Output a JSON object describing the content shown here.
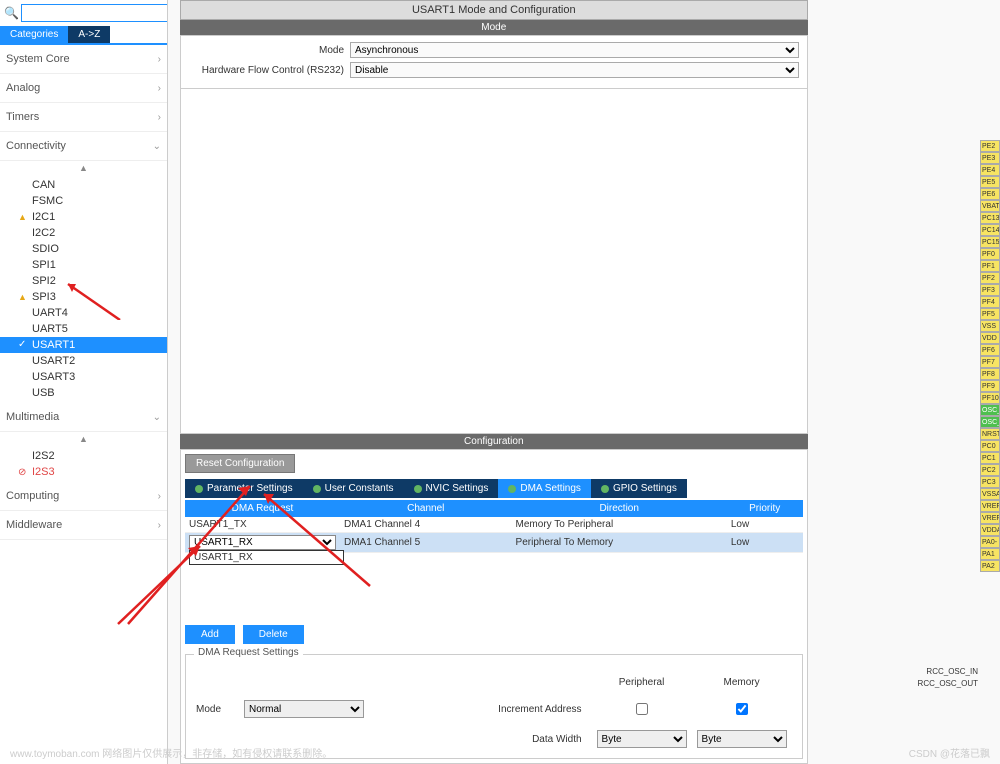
{
  "sidebar": {
    "tabs": {
      "cat": "Categories",
      "az": "A->Z"
    },
    "categories": [
      {
        "name": "System Core",
        "expanded": false
      },
      {
        "name": "Analog",
        "expanded": false
      },
      {
        "name": "Timers",
        "expanded": false
      },
      {
        "name": "Connectivity",
        "expanded": true,
        "items": [
          {
            "label": "CAN"
          },
          {
            "label": "FSMC"
          },
          {
            "label": "I2C1",
            "warn": true
          },
          {
            "label": "I2C2"
          },
          {
            "label": "SDIO"
          },
          {
            "label": "SPI1"
          },
          {
            "label": "SPI2"
          },
          {
            "label": "SPI3",
            "warn": true
          },
          {
            "label": "UART4"
          },
          {
            "label": "UART5"
          },
          {
            "label": "USART1",
            "checked": true,
            "selected": true
          },
          {
            "label": "USART2"
          },
          {
            "label": "USART3"
          },
          {
            "label": "USB"
          }
        ]
      },
      {
        "name": "Multimedia",
        "expanded": true,
        "items": [
          {
            "label": "I2S2"
          },
          {
            "label": "I2S3",
            "error": true
          }
        ]
      },
      {
        "name": "Computing",
        "expanded": false
      },
      {
        "name": "Middleware",
        "expanded": false
      }
    ]
  },
  "main": {
    "title": "USART1 Mode and Configuration",
    "mode_header": "Mode",
    "mode_label": "Mode",
    "mode_value": "Asynchronous",
    "flow_label": "Hardware Flow Control (RS232)",
    "flow_value": "Disable",
    "config_header": "Configuration",
    "reset_btn": "Reset Configuration",
    "cfg_tabs": [
      "Parameter Settings",
      "User Constants",
      "NVIC Settings",
      "DMA Settings",
      "GPIO Settings"
    ],
    "dma": {
      "headers": [
        "DMA Request",
        "Channel",
        "Direction",
        "Priority"
      ],
      "rows": [
        {
          "req": "USART1_TX",
          "ch": "DMA1 Channel 4",
          "dir": "Memory To Peripheral",
          "prio": "Low"
        },
        {
          "req": "USART1_RX",
          "ch": "DMA1 Channel 5",
          "dir": "Peripheral To Memory",
          "prio": "Low",
          "selected": true
        }
      ],
      "dropdown_option": "USART1_RX",
      "add": "Add",
      "delete": "Delete",
      "settings_legend": "DMA Request Settings",
      "mode_lbl": "Mode",
      "mode_val": "Normal",
      "inc_lbl": "Increment Address",
      "peripheral": "Peripheral",
      "memory": "Memory",
      "dw_lbl": "Data Width",
      "dw_val": "Byte"
    }
  },
  "pins_left_labels": [
    "RCC_OSC_IN",
    "RCC_OSC_OUT"
  ],
  "pins": [
    "PE2",
    "PE3",
    "PE4",
    "PE5",
    "PE6",
    "VBAT",
    "PC13",
    "PC14",
    "PC15",
    "PF0",
    "PF1",
    "PF2",
    "PF3",
    "PF4",
    "PF5",
    "VSS",
    "VDD",
    "PF6",
    "PF7",
    "PF8",
    "PF9",
    "PF10",
    "OSC_",
    "OSC_",
    "NRST",
    "PC0",
    "PC1",
    "PC2",
    "PC3",
    "VSSA",
    "VREF-",
    "VREF+",
    "VDDA",
    "PA0-",
    "PA1",
    "PA2"
  ],
  "footer": {
    "left": "www.toymoban.com 网络图片仅供展示，非存储，如有侵权请联系删除。",
    "right": "CSDN @花落已飘"
  }
}
